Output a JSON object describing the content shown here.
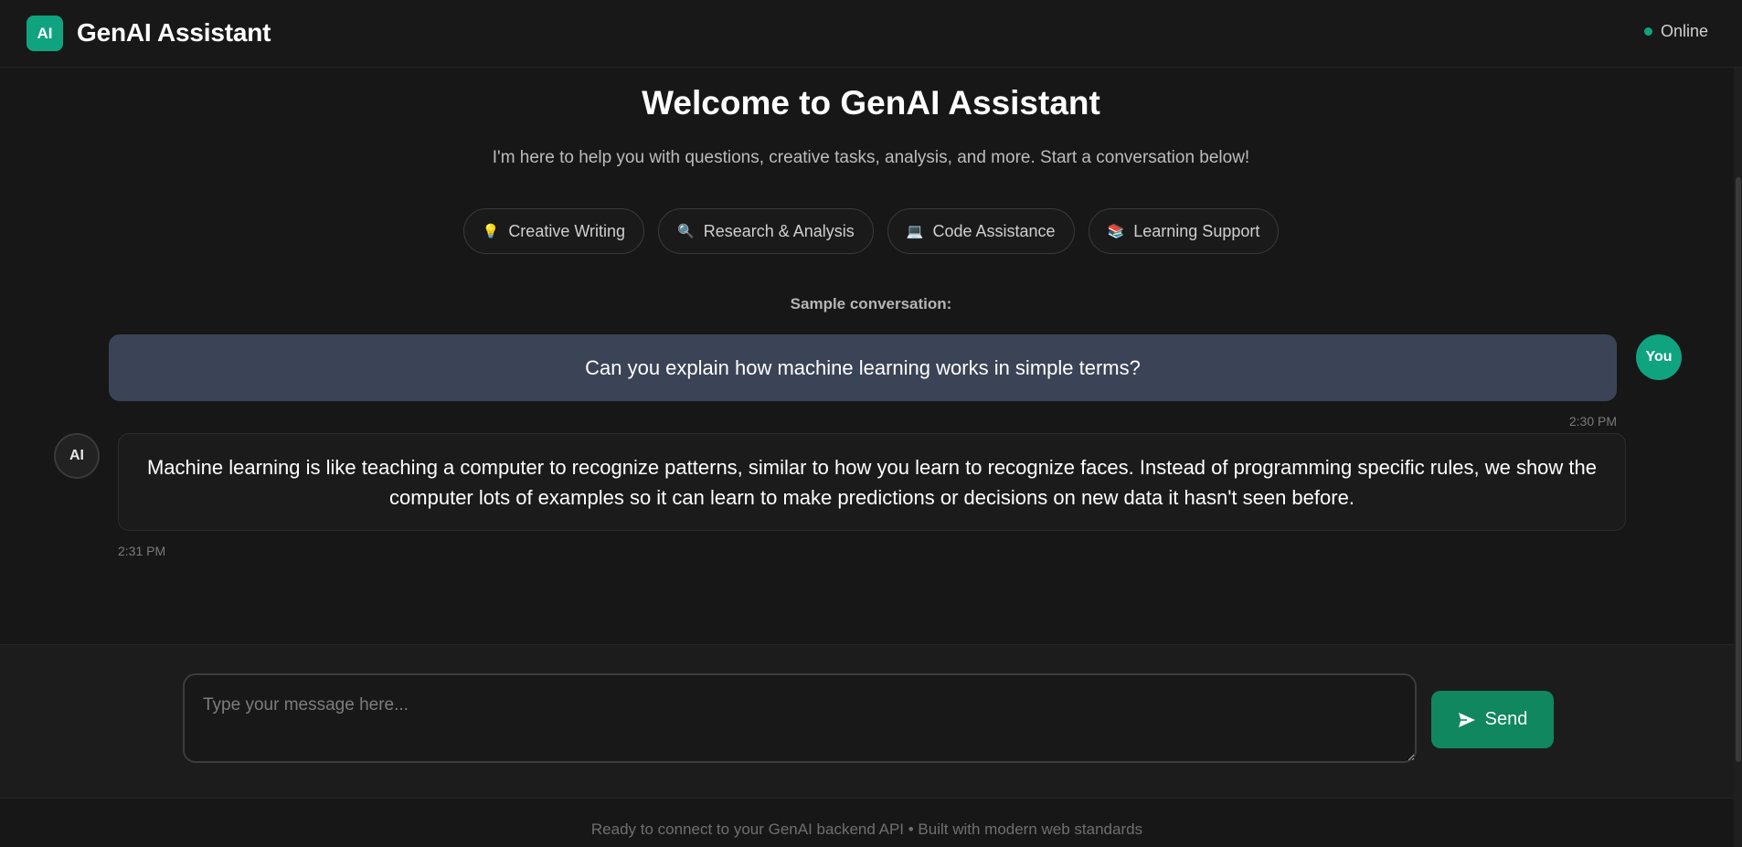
{
  "header": {
    "logo_text": "AI",
    "title": "GenAI Assistant",
    "status": "Online",
    "status_color": "#10a37f"
  },
  "welcome": {
    "title": "Welcome to GenAI Assistant",
    "subtitle": "I'm here to help you with questions, creative tasks, analysis, and more. Start a conversation below!",
    "chips": [
      {
        "icon": "💡",
        "icon_name": "lightbulb-icon",
        "label": "Creative Writing"
      },
      {
        "icon": "🔍",
        "icon_name": "magnifier-icon",
        "label": "Research & Analysis"
      },
      {
        "icon": "💻",
        "icon_name": "laptop-icon",
        "label": "Code Assistance"
      },
      {
        "icon": "📚",
        "icon_name": "books-icon",
        "label": "Learning Support"
      }
    ],
    "sample_label": "Sample conversation:"
  },
  "conversation": {
    "user": {
      "avatar": "You",
      "message": "Can you explain how machine learning works in simple terms?",
      "time": "2:30 PM"
    },
    "ai": {
      "avatar": "AI",
      "message": "Machine learning is like teaching a computer to recognize patterns, similar to how you learn to recognize faces. Instead of programming specific rules, we show the computer lots of examples so it can learn to make predictions or decisions on new data it hasn't seen before.",
      "time": "2:31 PM"
    }
  },
  "composer": {
    "placeholder": "Type your message here...",
    "value": "",
    "send_label": "Send",
    "accent": "#10875f"
  },
  "footer": {
    "text": "Ready to connect to your GenAI backend API • Built with modern web standards"
  }
}
